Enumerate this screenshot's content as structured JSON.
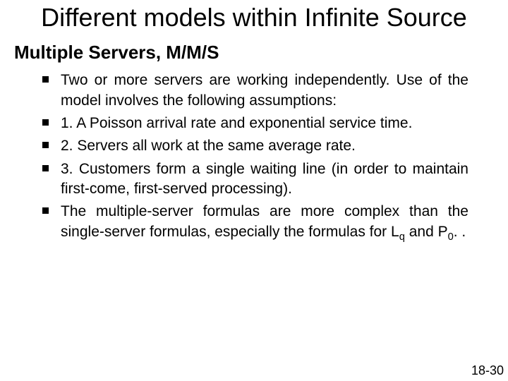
{
  "title": "Different models within Infinite Source",
  "subtitle": "Multiple Servers, M/M/S",
  "bullets": [
    "Two or more servers are working independently. Use of the model involves the following assumptions:",
    "1. A Poisson arrival rate and exponential service time.",
    "2. Servers all work at the same average rate.",
    "3. Customers form a single waiting line (in order to maintain first-come, first-served processing).",
    "The multiple-server formulas are more complex than the single-server formulas, especially the formulas for L_q and P_0. ."
  ],
  "page_number": "18-30"
}
